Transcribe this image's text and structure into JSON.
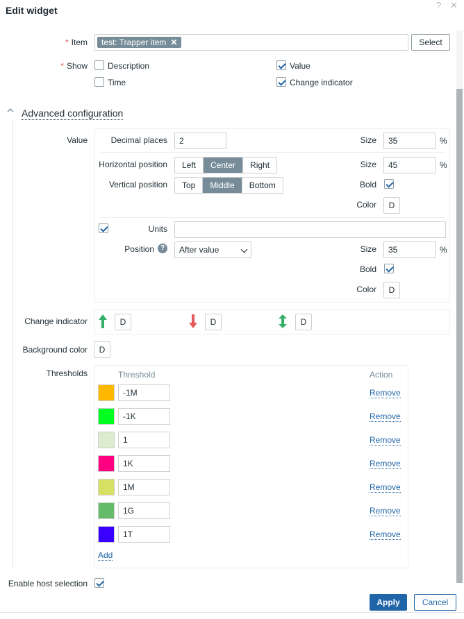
{
  "dialog": {
    "title": "Edit widget",
    "help_glyph": "?",
    "close_glyph": "✕"
  },
  "item": {
    "label": "Item",
    "required_mark": "*",
    "tag": "test: Trapper item",
    "tag_remove": "✕",
    "select_label": "Select"
  },
  "show": {
    "label": "Show",
    "required_mark": "*",
    "options": [
      {
        "label": "Description",
        "checked": false
      },
      {
        "label": "Time",
        "checked": false
      },
      {
        "label": "Value",
        "checked": true
      },
      {
        "label": "Change indicator",
        "checked": true
      }
    ]
  },
  "advanced": {
    "title": "Advanced configuration"
  },
  "value_section": {
    "label": "Value",
    "decimal_places_label": "Decimal places",
    "decimal_places_value": "2",
    "size_label": "Size",
    "decimal_size": "35",
    "pct": "%",
    "horizontal_position_label": "Horizontal position",
    "horizontal_options": [
      "Left",
      "Center",
      "Right"
    ],
    "horizontal_selected": "Center",
    "horizontal_size": "45",
    "vertical_position_label": "Vertical position",
    "vertical_options": [
      "Top",
      "Middle",
      "Bottom"
    ],
    "vertical_selected": "Middle",
    "bold_label": "Bold",
    "bold_checked": true,
    "color_label": "Color",
    "color_default": "D",
    "units_label": "Units",
    "units_checked": true,
    "units_value": "",
    "position_label": "Position",
    "position_help": "?",
    "position_value": "After value",
    "units_size": "35",
    "units_bold_checked": true
  },
  "change_indicator": {
    "label": "Change indicator",
    "up_color": "#34af67",
    "down_color": "#e45959",
    "updown_color": "#34af67",
    "default": "D"
  },
  "background_color": {
    "label": "Background color",
    "default": "D"
  },
  "thresholds": {
    "label": "Thresholds",
    "col_threshold": "Threshold",
    "col_action": "Action",
    "remove_label": "Remove",
    "add_label": "Add",
    "rows": [
      {
        "color": "#FFB800",
        "value": "-1M"
      },
      {
        "color": "#00FF1E",
        "value": "-1K"
      },
      {
        "color": "#DDEBCF",
        "value": "1"
      },
      {
        "color": "#FF0080",
        "value": "1K"
      },
      {
        "color": "#D6E063",
        "value": "1M"
      },
      {
        "color": "#66BB6A",
        "value": "1G"
      },
      {
        "color": "#3A00FF",
        "value": "1T"
      }
    ]
  },
  "host_selection": {
    "label": "Enable host selection",
    "checked": true
  },
  "footer": {
    "apply_label": "Apply",
    "cancel_label": "Cancel"
  }
}
